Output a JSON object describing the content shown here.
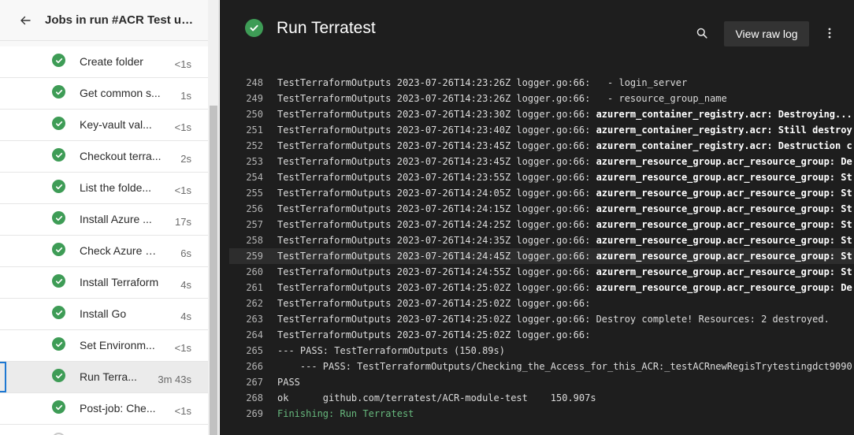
{
  "left_panel": {
    "header_title": "Jobs in run #ACR Test usi...",
    "back_icon": "arrow-left-icon",
    "steps": [
      {
        "name": "Create folder",
        "time": "<1s"
      },
      {
        "name": "Get common s...",
        "time": "1s"
      },
      {
        "name": "Key-vault val...",
        "time": "<1s"
      },
      {
        "name": "Checkout terra...",
        "time": "2s"
      },
      {
        "name": "List the folde...",
        "time": "<1s"
      },
      {
        "name": "Install Azure ...",
        "time": "17s"
      },
      {
        "name": "Check Azure C...",
        "time": "6s"
      },
      {
        "name": "Install Terraform",
        "time": "4s"
      },
      {
        "name": "Install Go",
        "time": "4s"
      },
      {
        "name": "Set Environm...",
        "time": "<1s"
      },
      {
        "name": "Run Terra...",
        "time": "3m 43s",
        "selected": true
      },
      {
        "name": "Post-job: Che...",
        "time": "<1s"
      }
    ],
    "status_icon": "success-check-icon",
    "success_color": "#3e9c56"
  },
  "right_panel": {
    "title": "Run Terratest",
    "view_raw_log_label": "View raw log",
    "search_icon": "search-icon",
    "more_icon": "more-vertical-icon",
    "log_lines": [
      {
        "n": "248",
        "text": "TestTerraformOutputs 2023-07-26T14:23:26Z logger.go:66:   - login_server"
      },
      {
        "n": "249",
        "text": "TestTerraformOutputs 2023-07-26T14:23:26Z logger.go:66:   - resource_group_name"
      },
      {
        "n": "250",
        "text": "TestTerraformOutputs 2023-07-26T14:23:30Z logger.go:66: ",
        "bold": "azurerm_container_registry.acr: Destroying..."
      },
      {
        "n": "251",
        "text": "TestTerraformOutputs 2023-07-26T14:23:40Z logger.go:66: ",
        "bold": "azurerm_container_registry.acr: Still destroy"
      },
      {
        "n": "252",
        "text": "TestTerraformOutputs 2023-07-26T14:23:45Z logger.go:66: ",
        "bold": "azurerm_container_registry.acr: Destruction c"
      },
      {
        "n": "253",
        "text": "TestTerraformOutputs 2023-07-26T14:23:45Z logger.go:66: ",
        "bold": "azurerm_resource_group.acr_resource_group: De"
      },
      {
        "n": "254",
        "text": "TestTerraformOutputs 2023-07-26T14:23:55Z logger.go:66: ",
        "bold": "azurerm_resource_group.acr_resource_group: St"
      },
      {
        "n": "255",
        "text": "TestTerraformOutputs 2023-07-26T14:24:05Z logger.go:66: ",
        "bold": "azurerm_resource_group.acr_resource_group: St"
      },
      {
        "n": "256",
        "text": "TestTerraformOutputs 2023-07-26T14:24:15Z logger.go:66: ",
        "bold": "azurerm_resource_group.acr_resource_group: St"
      },
      {
        "n": "257",
        "text": "TestTerraformOutputs 2023-07-26T14:24:25Z logger.go:66: ",
        "bold": "azurerm_resource_group.acr_resource_group: St"
      },
      {
        "n": "258",
        "text": "TestTerraformOutputs 2023-07-26T14:24:35Z logger.go:66: ",
        "bold": "azurerm_resource_group.acr_resource_group: St"
      },
      {
        "n": "259",
        "text": "TestTerraformOutputs 2023-07-26T14:24:45Z logger.go:66: ",
        "bold": "azurerm_resource_group.acr_resource_group: St",
        "highlight": true
      },
      {
        "n": "260",
        "text": "TestTerraformOutputs 2023-07-26T14:24:55Z logger.go:66: ",
        "bold": "azurerm_resource_group.acr_resource_group: St"
      },
      {
        "n": "261",
        "text": "TestTerraformOutputs 2023-07-26T14:25:02Z logger.go:66: ",
        "bold": "azurerm_resource_group.acr_resource_group: De"
      },
      {
        "n": "262",
        "text": "TestTerraformOutputs 2023-07-26T14:25:02Z logger.go:66:"
      },
      {
        "n": "263",
        "text": "TestTerraformOutputs 2023-07-26T14:25:02Z logger.go:66: Destroy complete! Resources: 2 destroyed."
      },
      {
        "n": "264",
        "text": "TestTerraformOutputs 2023-07-26T14:25:02Z logger.go:66:"
      },
      {
        "n": "265",
        "text": "--- PASS: TestTerraformOutputs (150.89s)"
      },
      {
        "n": "266",
        "text": "    --- PASS: TestTerraformOutputs/Checking_the_Access_for_this_ACR:_testACRnewRegisTrytestingdct9090"
      },
      {
        "n": "267",
        "text": "PASS"
      },
      {
        "n": "268",
        "text": "ok      github.com/terratest/ACR-module-test    150.907s"
      },
      {
        "n": "269",
        "text": "Finishing: Run Terratest",
        "green": true
      }
    ],
    "finishing_color": "#67b87d"
  }
}
